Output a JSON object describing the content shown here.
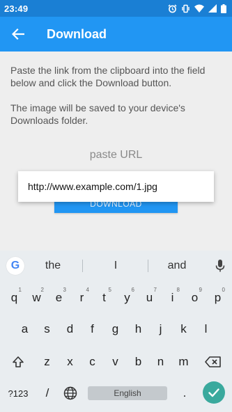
{
  "status_bar": {
    "time": "23:49",
    "icons": [
      "alarm-icon",
      "vibrate-icon",
      "wifi-icon",
      "signal-icon",
      "battery-icon"
    ]
  },
  "app_bar": {
    "title": "Download",
    "back_icon": "arrow-left-icon",
    "color": "#2196f3"
  },
  "content": {
    "instruction_1": "Paste the link from the clipboard into the field below and click the Download button.",
    "instruction_2": "The image will be saved to your device's Downloads folder.",
    "url_field_placeholder": "paste URL",
    "download_button_label": "DOWNLOAD",
    "clipboard_suggestion": "http://www.example.com/1.jpg"
  },
  "keyboard": {
    "suggestions": [
      "the",
      "I",
      "and"
    ],
    "row1": [
      {
        "key": "q",
        "hint": "1"
      },
      {
        "key": "w",
        "hint": "2"
      },
      {
        "key": "e",
        "hint": "3"
      },
      {
        "key": "r",
        "hint": "4"
      },
      {
        "key": "t",
        "hint": "5"
      },
      {
        "key": "y",
        "hint": "6"
      },
      {
        "key": "u",
        "hint": "7"
      },
      {
        "key": "i",
        "hint": "8"
      },
      {
        "key": "o",
        "hint": "9"
      },
      {
        "key": "p",
        "hint": "0"
      }
    ],
    "row2": [
      "a",
      "s",
      "d",
      "f",
      "g",
      "h",
      "j",
      "k",
      "l"
    ],
    "row3": [
      "z",
      "x",
      "c",
      "v",
      "b",
      "n",
      "m"
    ],
    "symbols_label": "?123",
    "slash_label": "/",
    "space_label": "English",
    "period_label": ".",
    "enter_color": "#3aa99d"
  }
}
